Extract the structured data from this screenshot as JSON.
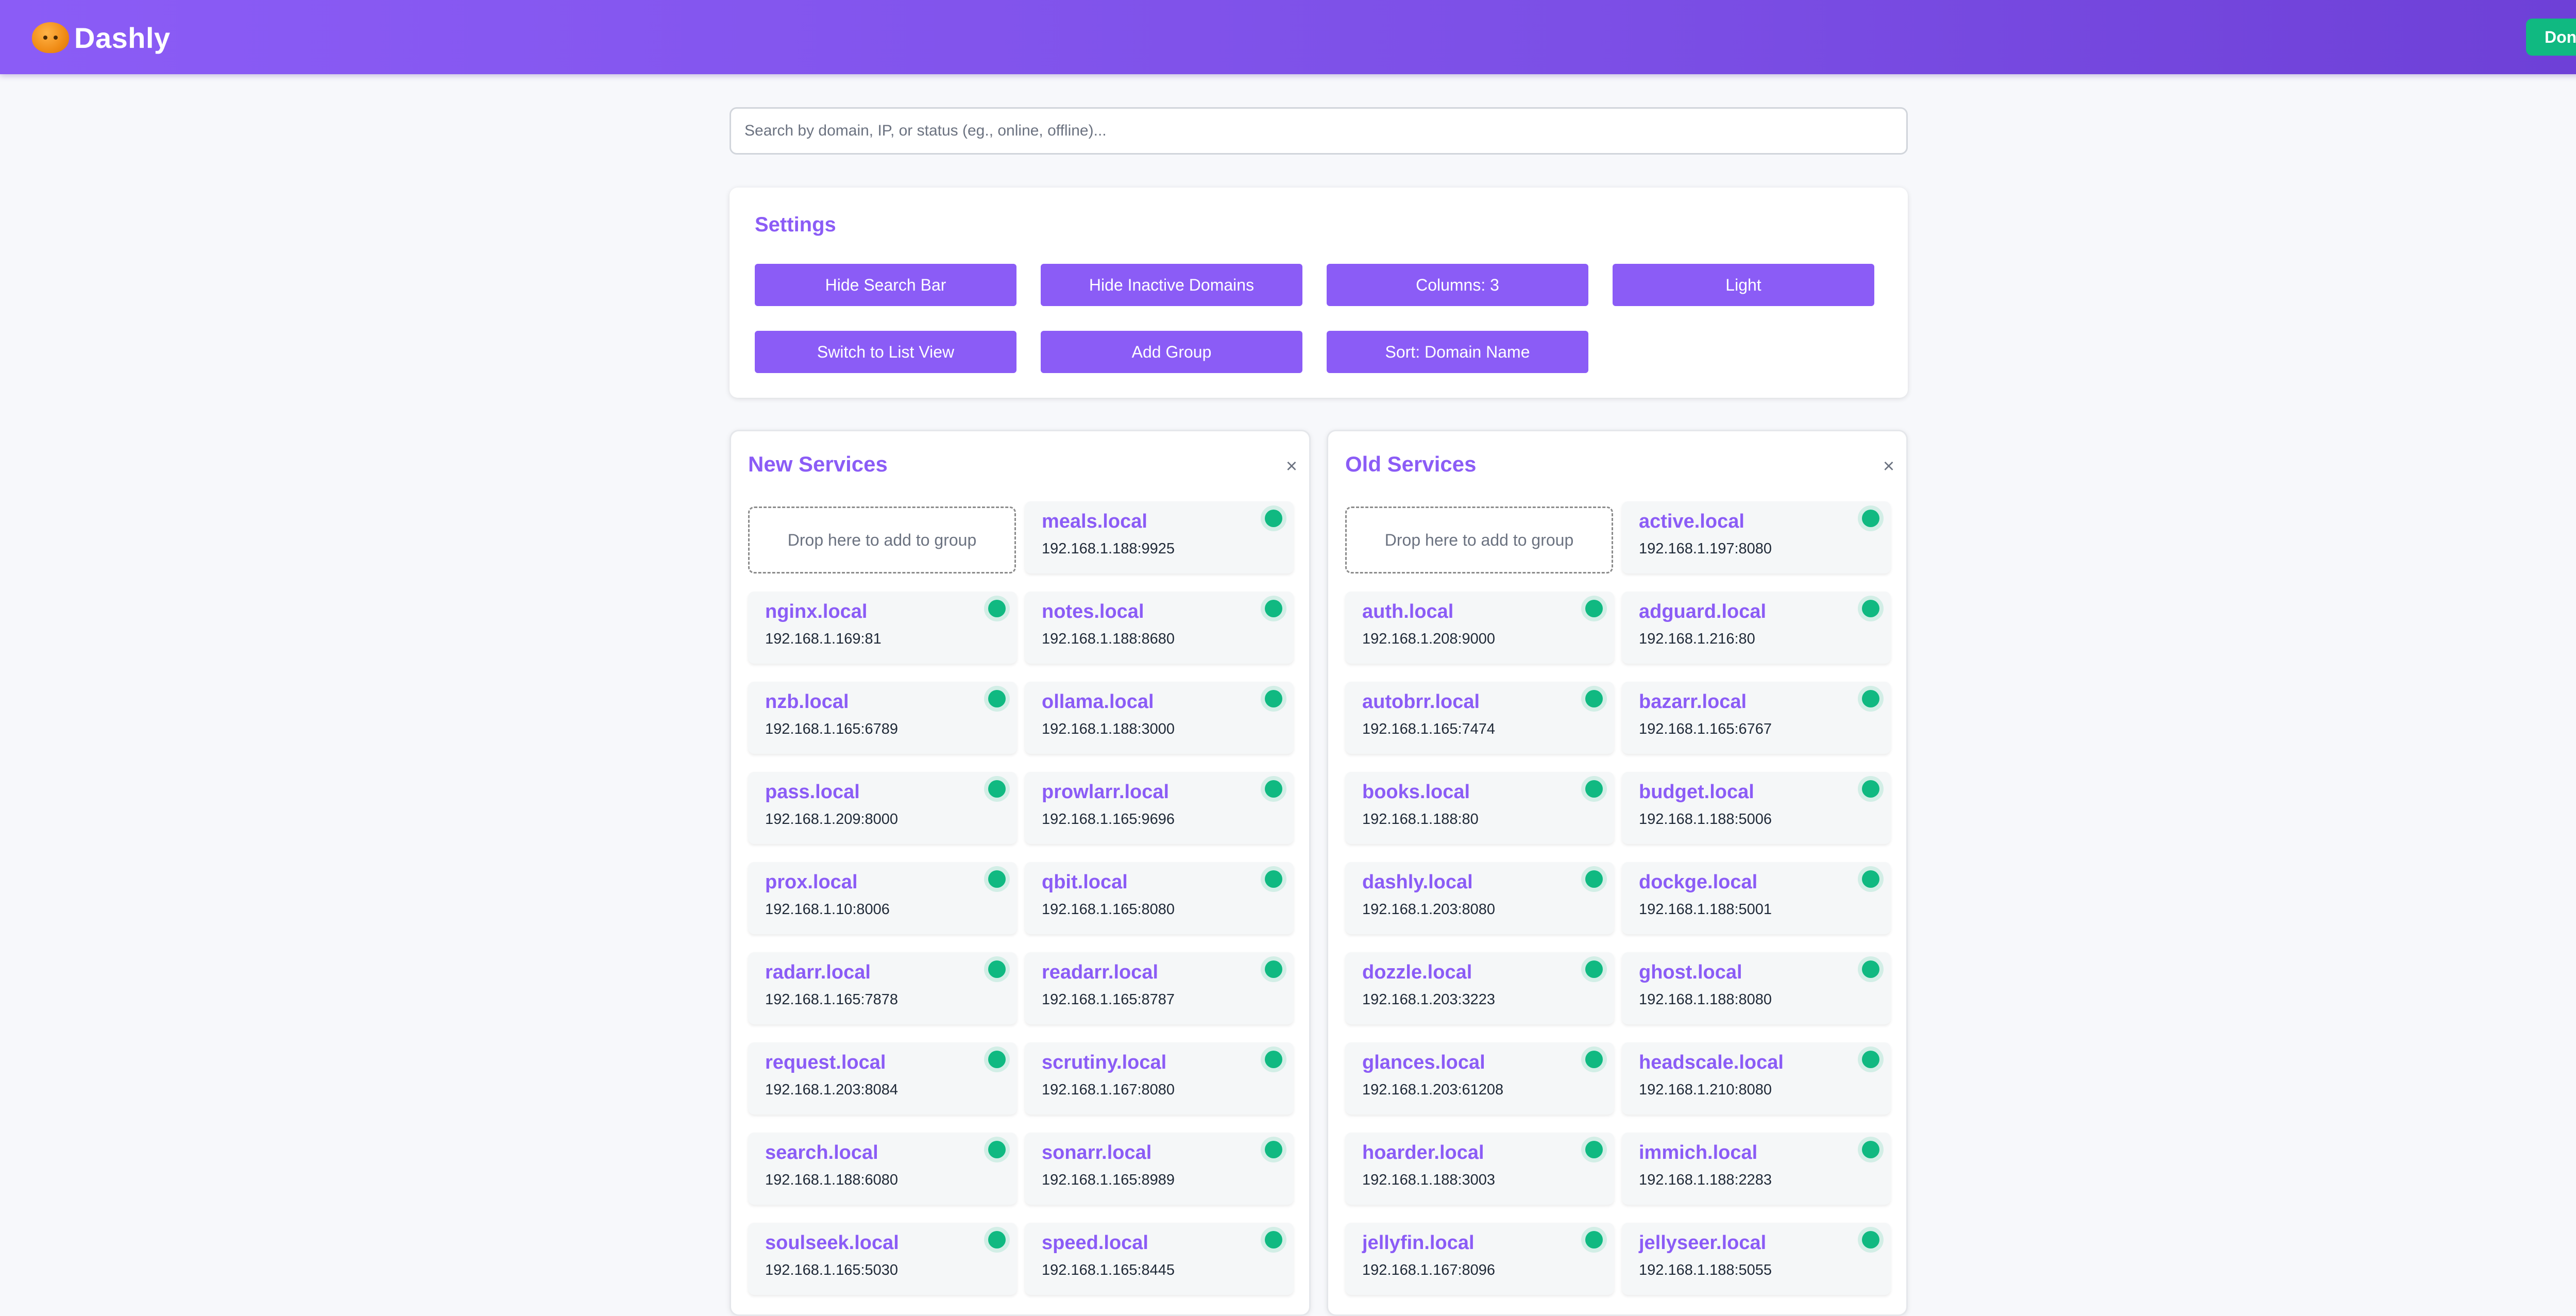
{
  "header": {
    "brand": "Dashly",
    "done_label": "Done"
  },
  "search": {
    "placeholder": "Search by domain, IP, or status (eg., online, offline)..."
  },
  "settings": {
    "title": "Settings",
    "buttons": [
      "Hide Search Bar",
      "Hide Inactive Domains",
      "Columns: 3",
      "Light",
      "Switch to List View",
      "Add Group",
      "Sort: Domain Name"
    ]
  },
  "colors": {
    "accent": "#8b5cf6",
    "online": "#10b981",
    "done": "#10b981"
  },
  "groups": [
    {
      "title": "New Services",
      "close": "×",
      "drop_label": "Drop here to add to group",
      "services": [
        {
          "name": "meals.local",
          "ip": "192.168.1.188:9925",
          "status": "online"
        },
        {
          "name": "nginx.local",
          "ip": "192.168.1.169:81",
          "status": "online"
        },
        {
          "name": "notes.local",
          "ip": "192.168.1.188:8680",
          "status": "online"
        },
        {
          "name": "nzb.local",
          "ip": "192.168.1.165:6789",
          "status": "online"
        },
        {
          "name": "ollama.local",
          "ip": "192.168.1.188:3000",
          "status": "online"
        },
        {
          "name": "pass.local",
          "ip": "192.168.1.209:8000",
          "status": "online"
        },
        {
          "name": "prowlarr.local",
          "ip": "192.168.1.165:9696",
          "status": "online"
        },
        {
          "name": "prox.local",
          "ip": "192.168.1.10:8006",
          "status": "online"
        },
        {
          "name": "qbit.local",
          "ip": "192.168.1.165:8080",
          "status": "online"
        },
        {
          "name": "radarr.local",
          "ip": "192.168.1.165:7878",
          "status": "online"
        },
        {
          "name": "readarr.local",
          "ip": "192.168.1.165:8787",
          "status": "online"
        },
        {
          "name": "request.local",
          "ip": "192.168.1.203:8084",
          "status": "online"
        },
        {
          "name": "scrutiny.local",
          "ip": "192.168.1.167:8080",
          "status": "online"
        },
        {
          "name": "search.local",
          "ip": "192.168.1.188:6080",
          "status": "online"
        },
        {
          "name": "sonarr.local",
          "ip": "192.168.1.165:8989",
          "status": "online"
        },
        {
          "name": "soulseek.local",
          "ip": "192.168.1.165:5030",
          "status": "online"
        },
        {
          "name": "speed.local",
          "ip": "192.168.1.165:8445",
          "status": "online"
        }
      ]
    },
    {
      "title": "Old Services",
      "close": "×",
      "drop_label": "Drop here to add to group",
      "services": [
        {
          "name": "active.local",
          "ip": "192.168.1.197:8080",
          "status": "online"
        },
        {
          "name": "auth.local",
          "ip": "192.168.1.208:9000",
          "status": "online"
        },
        {
          "name": "adguard.local",
          "ip": "192.168.1.216:80",
          "status": "online"
        },
        {
          "name": "autobrr.local",
          "ip": "192.168.1.165:7474",
          "status": "online"
        },
        {
          "name": "bazarr.local",
          "ip": "192.168.1.165:6767",
          "status": "online"
        },
        {
          "name": "books.local",
          "ip": "192.168.1.188:80",
          "status": "online"
        },
        {
          "name": "budget.local",
          "ip": "192.168.1.188:5006",
          "status": "online"
        },
        {
          "name": "dashly.local",
          "ip": "192.168.1.203:8080",
          "status": "online"
        },
        {
          "name": "dockge.local",
          "ip": "192.168.1.188:5001",
          "status": "online"
        },
        {
          "name": "dozzle.local",
          "ip": "192.168.1.203:3223",
          "status": "online"
        },
        {
          "name": "ghost.local",
          "ip": "192.168.1.188:8080",
          "status": "online"
        },
        {
          "name": "glances.local",
          "ip": "192.168.1.203:61208",
          "status": "online"
        },
        {
          "name": "headscale.local",
          "ip": "192.168.1.210:8080",
          "status": "online"
        },
        {
          "name": "hoarder.local",
          "ip": "192.168.1.188:3003",
          "status": "online"
        },
        {
          "name": "immich.local",
          "ip": "192.168.1.188:2283",
          "status": "online"
        },
        {
          "name": "jellyfin.local",
          "ip": "192.168.1.167:8096",
          "status": "online"
        },
        {
          "name": "jellyseer.local",
          "ip": "192.168.1.188:5055",
          "status": "online"
        }
      ]
    }
  ]
}
